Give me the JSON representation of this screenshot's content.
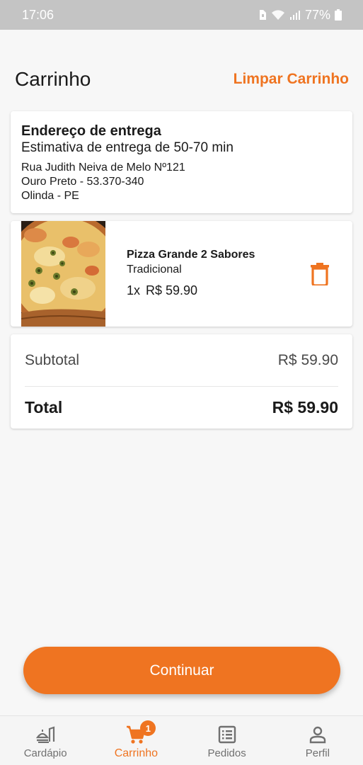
{
  "status_bar": {
    "time": "17:06",
    "battery": "77%"
  },
  "header": {
    "title": "Carrinho",
    "clear_label": "Limpar Carrinho"
  },
  "address": {
    "heading": "Endereço de entrega",
    "estimate": "Estimativa de entrega de 50-70 min",
    "street": "Rua Judith Neiva de Melo Nº121",
    "district": "Ouro Preto - 53.370-340",
    "city": "Olinda - PE"
  },
  "cart_item": {
    "name": "Pizza Grande 2 Sabores",
    "flavor": "Tradicional",
    "quantity": "1x",
    "price": "R$ 59.90",
    "image_icon": "pizza-image"
  },
  "totals": {
    "subtotal_label": "Subtotal",
    "subtotal_value": "R$ 59.90",
    "total_label": "Total",
    "total_value": "R$ 59.90"
  },
  "continue_label": "Continuar",
  "bottom_nav": {
    "items": [
      {
        "label": "Cardápio",
        "icon": "menu-food-icon"
      },
      {
        "label": "Carrinho",
        "icon": "cart-icon",
        "badge": "1"
      },
      {
        "label": "Pedidos",
        "icon": "orders-list-icon"
      },
      {
        "label": "Perfil",
        "icon": "profile-icon"
      }
    ],
    "active_index": 1
  },
  "colors": {
    "accent": "#ef7421",
    "background": "#f7f7f7",
    "card": "#ffffff"
  }
}
